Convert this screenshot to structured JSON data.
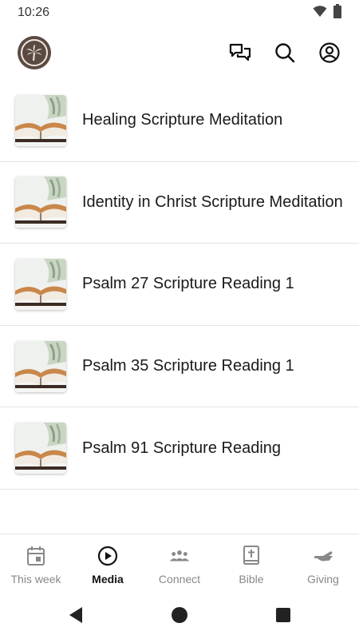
{
  "status_bar": {
    "time": "10:26",
    "icons": [
      "wifi-icon",
      "battery-icon"
    ]
  },
  "app_bar": {
    "logo": "palm-tree-logo",
    "actions": [
      "chat-icon",
      "search-icon",
      "account-icon"
    ]
  },
  "media_list": [
    {
      "title": "Healing Scripture Meditation",
      "thumbnail": "open-bible-thumbnail"
    },
    {
      "title": "Identity in Christ Scripture Meditation",
      "thumbnail": "open-bible-thumbnail"
    },
    {
      "title": "Psalm 27 Scripture Reading 1",
      "thumbnail": "open-bible-thumbnail"
    },
    {
      "title": "Psalm 35 Scripture Reading 1",
      "thumbnail": "open-bible-thumbnail"
    },
    {
      "title": "Psalm 91 Scripture Reading",
      "thumbnail": "open-bible-thumbnail"
    }
  ],
  "tab_bar": {
    "active": "Media",
    "tabs": [
      {
        "label": "This week",
        "icon": "calendar-icon"
      },
      {
        "label": "Media",
        "icon": "play-circle-icon"
      },
      {
        "label": "Connect",
        "icon": "group-icon"
      },
      {
        "label": "Bible",
        "icon": "bible-icon"
      },
      {
        "label": "Giving",
        "icon": "giving-hand-icon"
      }
    ]
  },
  "system_nav": [
    "back-icon",
    "home-icon",
    "recents-icon"
  ],
  "colors": {
    "logo_bg": "#5a4a42",
    "active_tab": "#111111",
    "inactive_tab": "#888888",
    "divider": "#e4e4e4"
  }
}
